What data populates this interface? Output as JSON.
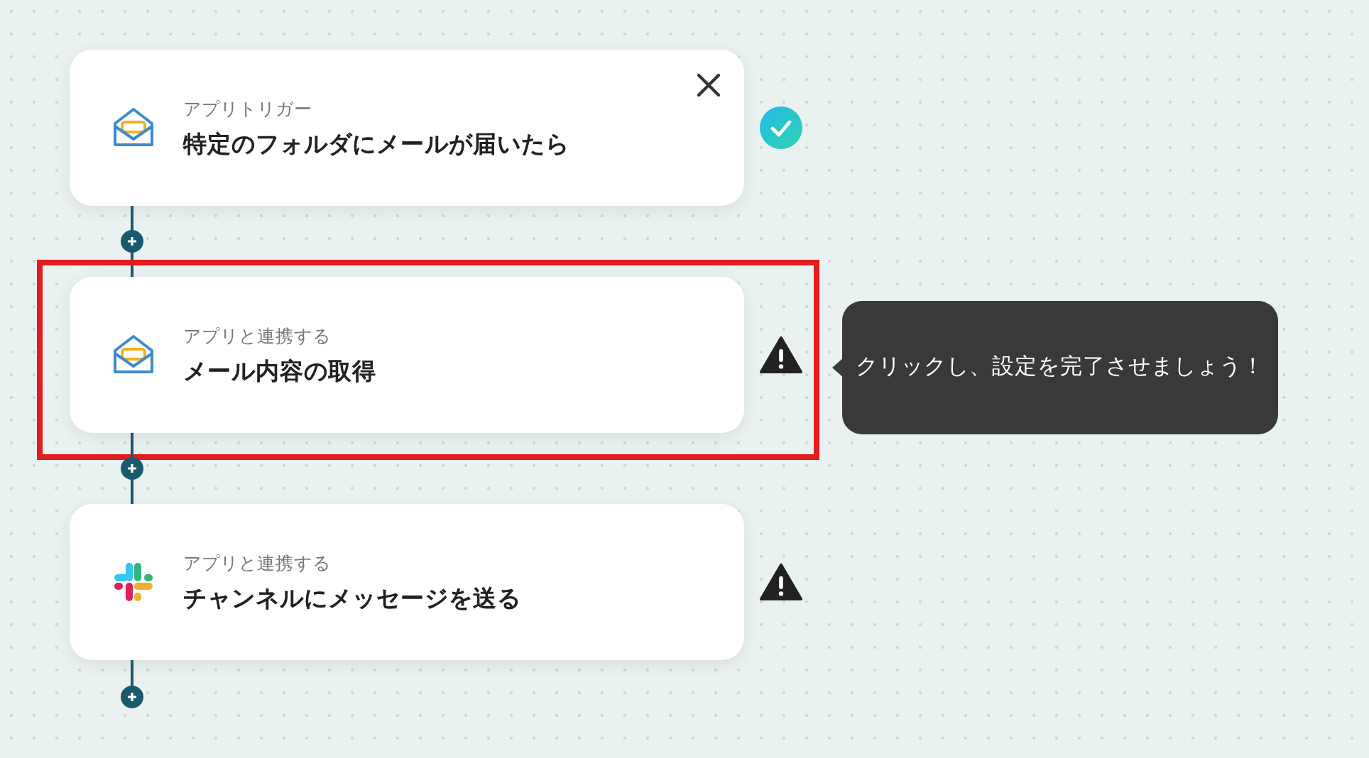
{
  "steps": [
    {
      "kind": "mail",
      "category": "アプリトリガー",
      "title": "特定のフォルダにメールが届いたら",
      "completed": true,
      "close_button": true,
      "highlighted": false
    },
    {
      "kind": "mail",
      "category": "アプリと連携する",
      "title": "メール内容の取得",
      "completed": false,
      "close_button": false,
      "highlighted": true,
      "tooltip": "クリックし、設定を完了させましょう！"
    },
    {
      "kind": "chat",
      "category": "アプリと連携する",
      "title": "チャンネルにメッセージを送る",
      "completed": false,
      "close_button": false,
      "highlighted": false
    }
  ]
}
